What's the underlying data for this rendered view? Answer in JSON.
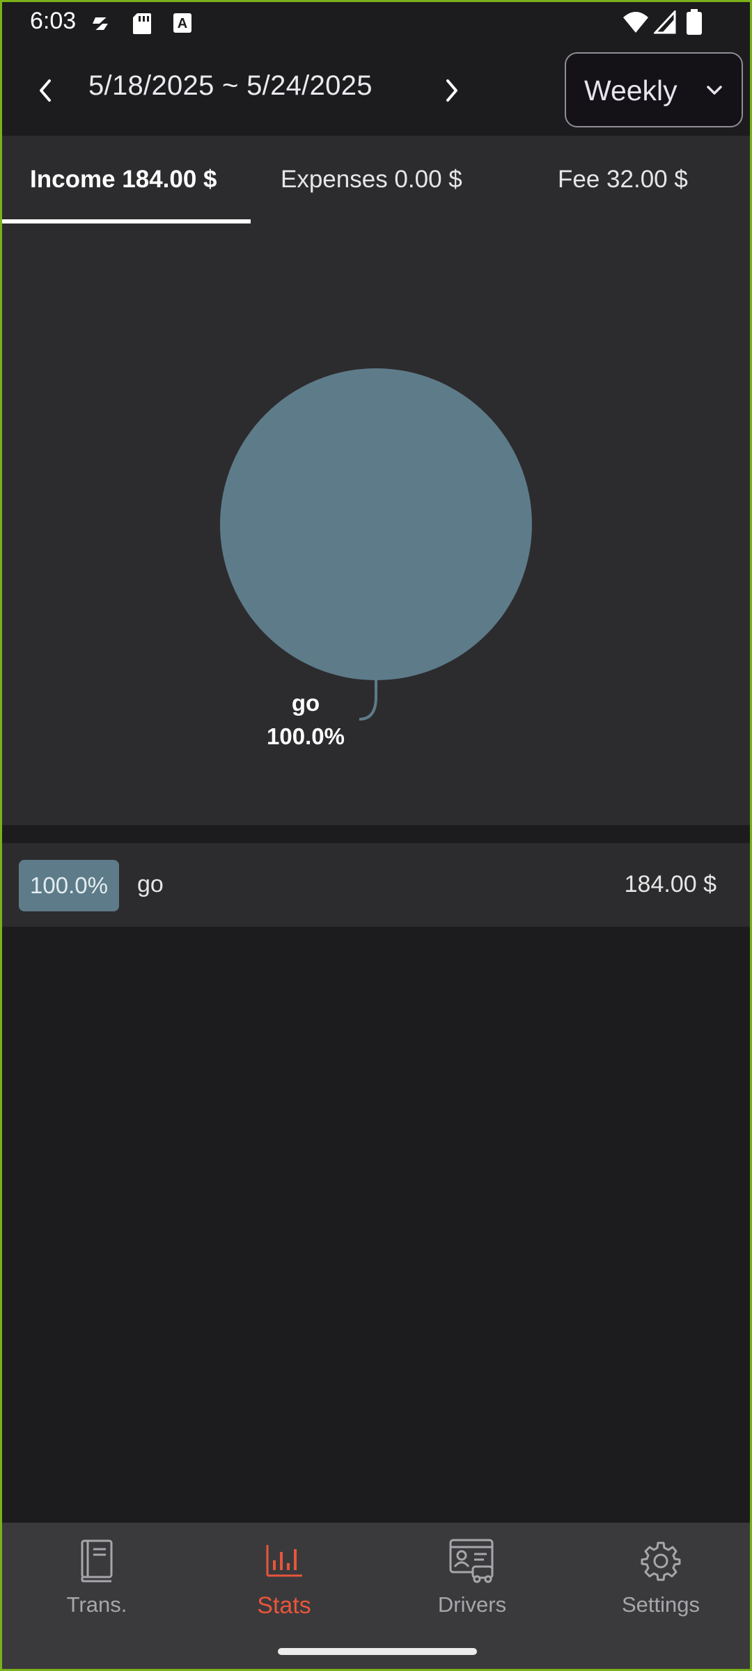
{
  "status_bar": {
    "time": "6:03",
    "left_icons": [
      "ringtone-off-icon",
      "sd-card-icon",
      "keyboard-a-icon"
    ],
    "right_icons": [
      "wifi-icon",
      "signal-icon",
      "battery-icon"
    ]
  },
  "header": {
    "date_range": "5/18/2025 ~ 5/24/2025",
    "period": "Weekly"
  },
  "tabs": [
    {
      "label": "Income 184.00 $",
      "active": true
    },
    {
      "label": "Expenses 0.00 $",
      "active": false
    },
    {
      "label": "Fee 32.00 $",
      "active": false
    }
  ],
  "chart_data": {
    "type": "pie",
    "slices": [
      {
        "label": "go",
        "value": 100.0,
        "percent_label": "100.0%",
        "color": "#5e7b89"
      }
    ]
  },
  "list": [
    {
      "percent": "100.0%",
      "name": "go",
      "amount": "184.00 $",
      "color": "#5e7b89"
    }
  ],
  "bottom_nav": [
    {
      "label": "Trans.",
      "icon": "book-icon",
      "active": false
    },
    {
      "label": "Stats",
      "icon": "bar-chart-icon",
      "active": true
    },
    {
      "label": "Drivers",
      "icon": "driver-card-icon",
      "active": false
    },
    {
      "label": "Settings",
      "icon": "gear-icon",
      "active": false
    }
  ],
  "colors": {
    "accent": "#e8553a",
    "slice": "#5e7b89",
    "background": "#1c1c1e",
    "panel": "#2c2c2e"
  }
}
